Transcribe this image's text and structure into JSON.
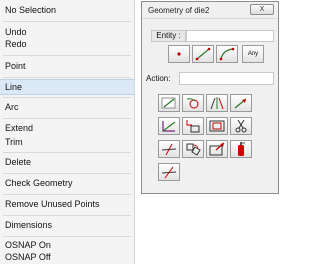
{
  "menu": {
    "items": [
      {
        "label": "No Selection"
      },
      {
        "label": "Undo"
      },
      {
        "label": "Redo"
      },
      {
        "label": "Point"
      },
      {
        "label": "Line"
      },
      {
        "label": "Arc"
      },
      {
        "label": "Extend"
      },
      {
        "label": "Trim"
      },
      {
        "label": "Delete"
      },
      {
        "label": "Check Geometry"
      },
      {
        "label": "Remove Unused Points"
      },
      {
        "label": "Dimensions"
      },
      {
        "label": "OSNAP On"
      },
      {
        "label": "OSNAP Off"
      }
    ],
    "highlighted_item": "Line",
    "highlight_color": "#dbe8f6"
  },
  "dialog": {
    "title": "Geometry of die2",
    "close_label": "X",
    "entity_label": "Entity :",
    "entity_value": "",
    "any_label": "Any",
    "action_label": "Action:",
    "action_value": "",
    "entity_icons": [
      "point-icon",
      "line-icon",
      "arc-icon"
    ],
    "action_icons": [
      "create-line-icon",
      "circle-tangent-icon",
      "mirror-icon",
      "arrow-extend-icon",
      "angle-line-icon",
      "offset-rectangle-icon",
      "rectangle-icon",
      "scissors-icon",
      "trim-line-icon",
      "rotate-shape-icon",
      "scale-rectangle-icon",
      "fire-extinguisher-icon",
      "extend-line-icon"
    ]
  }
}
